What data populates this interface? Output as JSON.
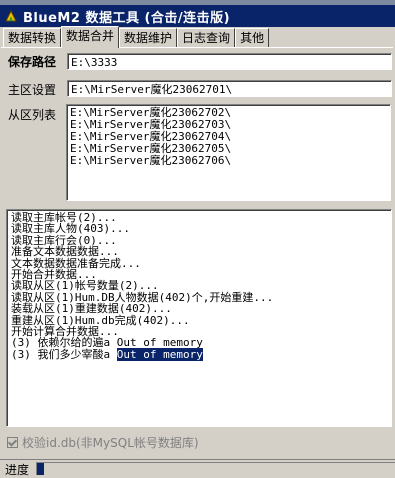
{
  "window": {
    "title": "BlueM2 数据工具 (合击/连击版)",
    "icon": "bluem2-app-icon"
  },
  "tabs": [
    {
      "label": "数据转换",
      "active": false
    },
    {
      "label": "数据合并",
      "active": true
    },
    {
      "label": "数据维护",
      "active": false
    },
    {
      "label": "日志查询",
      "active": false
    },
    {
      "label": "其他",
      "active": false
    }
  ],
  "form": {
    "save_path_label": "保存路径",
    "save_path_value": "E:\\3333",
    "main_area_label": "主区设置",
    "main_area_value": "E:\\MirServer魔化23062701\\",
    "sub_area_label": "从区列表",
    "sub_area_items": [
      "E:\\MirServer魔化23062702\\",
      "E:\\MirServer魔化23062703\\",
      "E:\\MirServer魔化23062704\\",
      "E:\\MirServer魔化23062705\\",
      "E:\\MirServer魔化23062706\\"
    ]
  },
  "log": {
    "lines": [
      {
        "text": "读取主库帐号(2)..."
      },
      {
        "text": "读取主库人物(403)..."
      },
      {
        "text": "读取主库行会(0)..."
      },
      {
        "text": "准备文本数据数据..."
      },
      {
        "text": "文本数据数据准备完成..."
      },
      {
        "text": "开始合并数据..."
      },
      {
        "text": "读取从区(1)帐号数量(2)..."
      },
      {
        "text": "读取从区(1)Hum.DB人物数据(402)个,开始重建..."
      },
      {
        "text": "装载从区(1)重建数据(402)..."
      },
      {
        "text": "重建从区(1)Hum.db完成(402)..."
      },
      {
        "text": "开始计算合并数据..."
      },
      {
        "text": "(3) 依赖尔给的遍a ",
        "highlight": "Out of memory",
        "selected": false
      },
      {
        "text": "(3) 我们多少宰酸a ",
        "highlight": "Out of memory",
        "selected": true
      }
    ]
  },
  "checkbox": {
    "label": "校验id.db(非MySQL帐号数据库)",
    "checked": true,
    "enabled": false
  },
  "status": {
    "label": "进度",
    "progress": 0.02,
    "accent": "#0a246a"
  }
}
